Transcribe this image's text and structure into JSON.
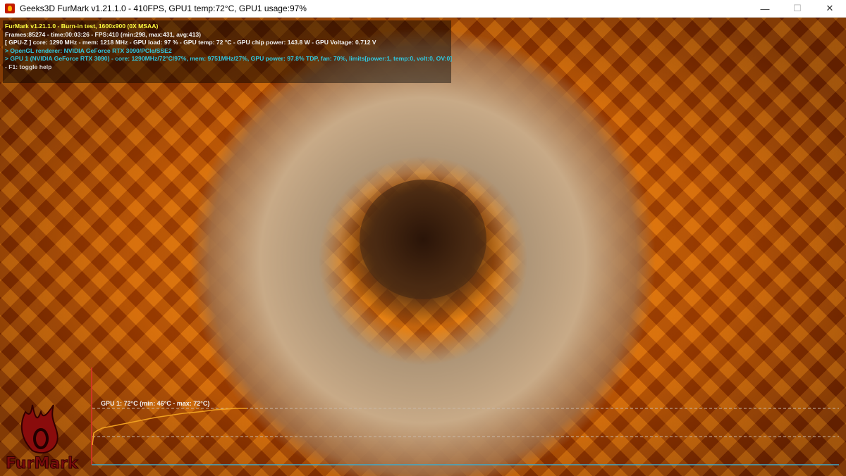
{
  "window": {
    "title": "Geeks3D FurMark v1.21.1.0 - 410FPS, GPU1 temp:72°C, GPU1 usage:97%",
    "minimize": "—",
    "maximize": "☐",
    "close": "✕"
  },
  "hud": {
    "line1": "FurMark v1.21.1.0 - Burn-in test, 1600x900 (0X MSAA)",
    "line2": "Frames:85274 - time:00:03:26 - FPS:410 (min:298, max:431, avg:413)",
    "line3": "[ GPU-Z ] core: 1290 MHz - mem: 1218 MHz - GPU load: 97 % - GPU temp: 72 °C - GPU chip power: 143.8 W - GPU Voltage: 0.712 V",
    "line4": "> OpenGL renderer: NVIDIA GeForce RTX 3090/PCIe/SSE2",
    "line5": "> GPU 1 (NVIDIA GeForce RTX 3090) - core: 1290MHz/72°C/97%, mem: 9751MHz/27%, GPU power: 97.8% TDP, fan: 70%, limits[power:1, temp:0, volt:0, OV:0]",
    "line6": "- F1: toggle help"
  },
  "logo": {
    "text": "FurMark"
  },
  "temp_graph": {
    "label": "GPU 1: 72°C (min: 46°C - max: 72°C)",
    "min": 46,
    "max": 72,
    "samples": [
      46,
      54.5,
      56,
      58,
      59.5,
      61.5,
      63.5,
      65.5,
      67,
      68.5,
      69.2,
      70,
      71,
      71.5,
      72,
      72,
      72
    ],
    "colors": {
      "line": "#f0a020",
      "axis_y": "#e03030",
      "axis_x": "#40a8c8",
      "dash": "#c8b8a8"
    }
  }
}
